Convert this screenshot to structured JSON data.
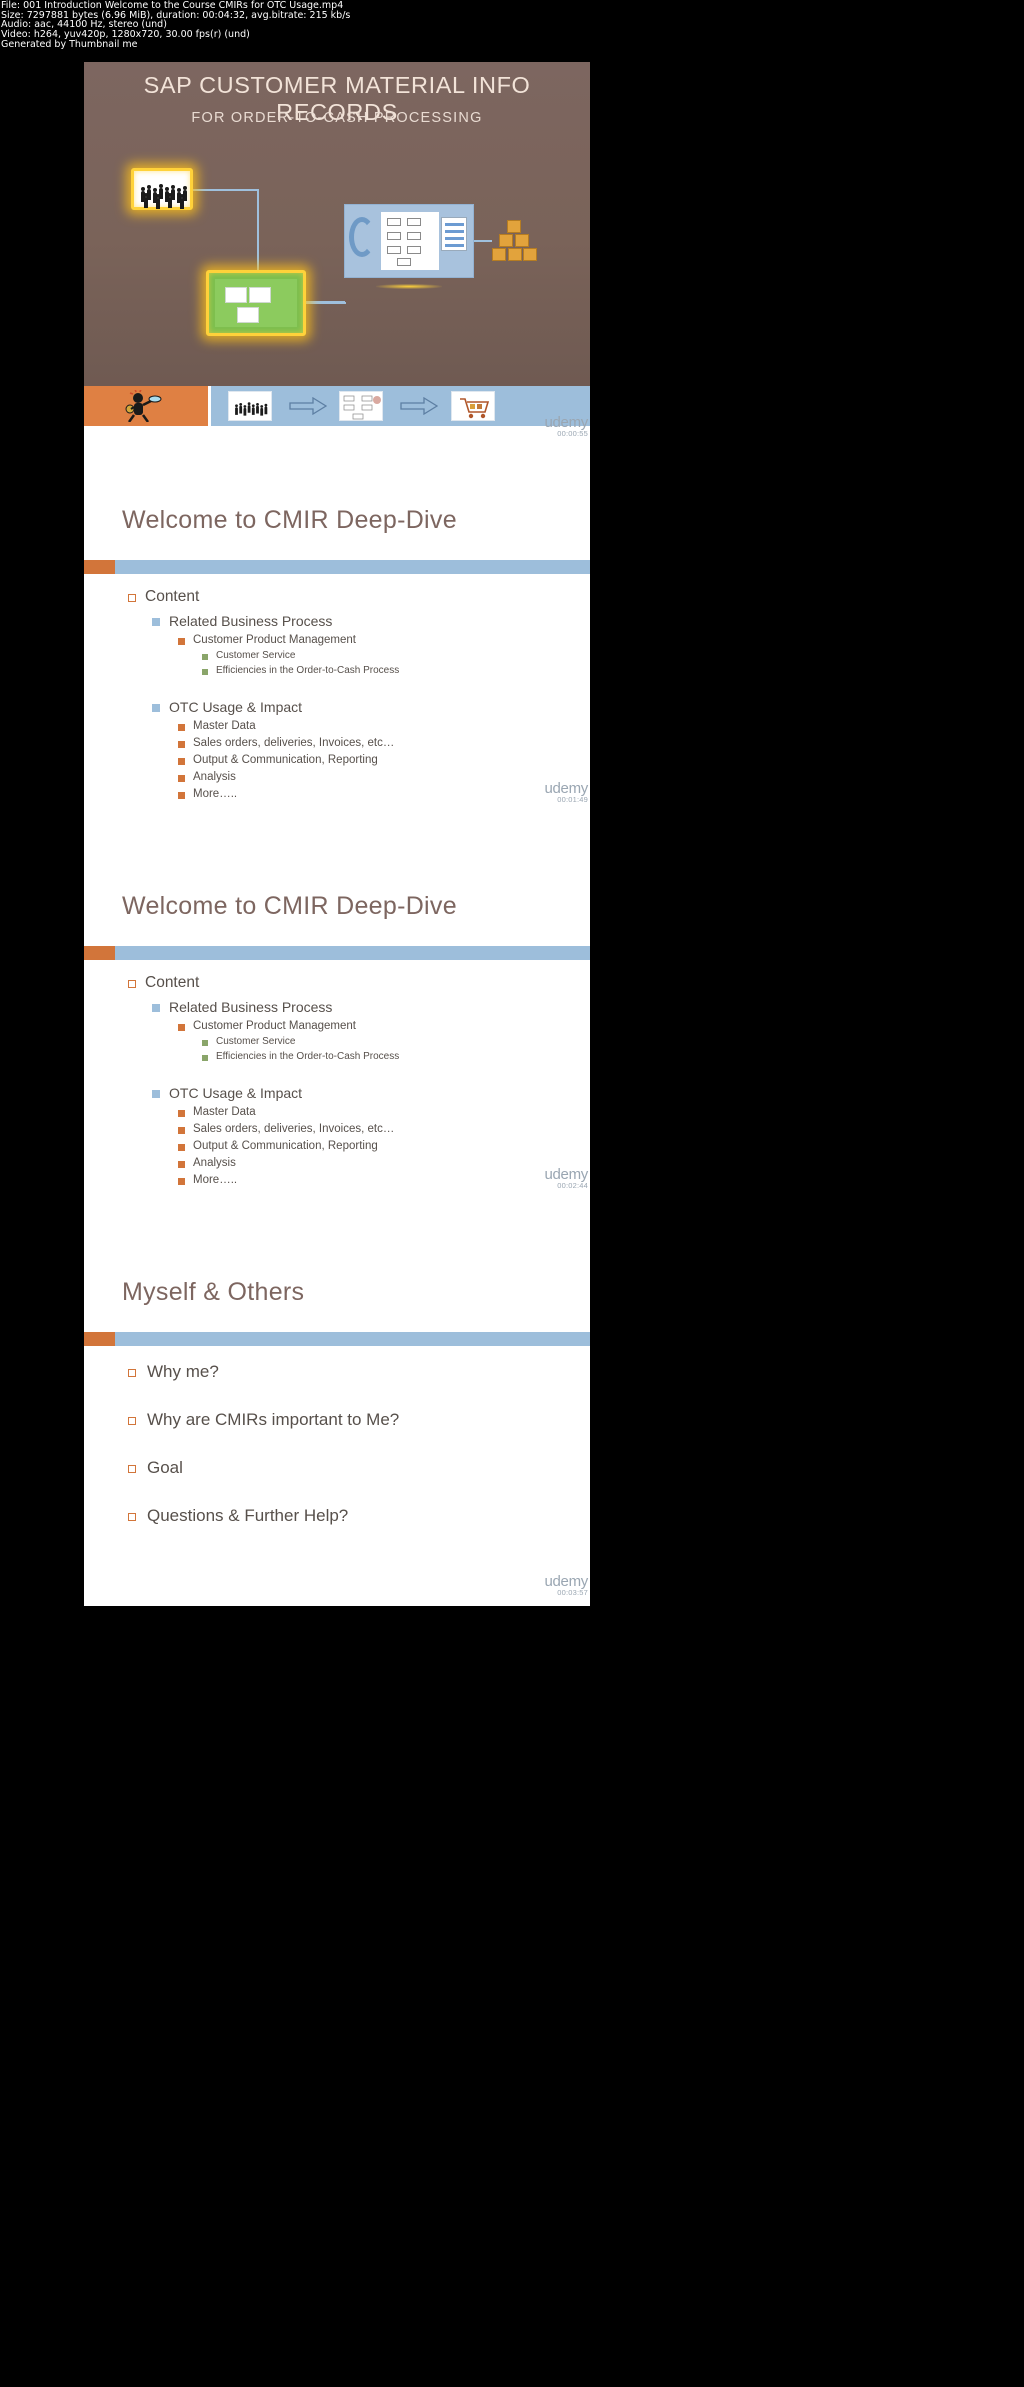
{
  "meta": {
    "line1": "File: 001 Introduction  Welcome to the Course CMIRs for OTC Usage.mp4",
    "line2": "Size: 7297881 bytes (6.96 MiB), duration: 00:04:32, avg.bitrate: 215 kb/s",
    "line3": "Audio: aac, 44100 Hz, stereo (und)",
    "line4": "Video: h264, yuv420p, 1280x720, 30.00 fps(r) (und)",
    "line5": "Generated by Thumbnail me"
  },
  "colors": {
    "slide_brown": "#7d6660",
    "strip_blue": "#9dbedb",
    "strip_orange": "#df8043",
    "accent_orange": "#d2753a",
    "bullet_green": "#8aa56a",
    "title_text": "#f2e3d8",
    "body_text": "#57504b",
    "glow_yellow": "#ffd23a"
  },
  "frames": [
    {
      "type": "title",
      "timecode": "00:00:55",
      "watermark": "udemy",
      "heading": "SAP CUSTOMER MATERIAL INFO RECORDS",
      "subheading": "FOR ORDER-TO-CASH PROCESSING"
    },
    {
      "type": "content",
      "timecode": "00:01:49",
      "watermark": "udemy",
      "title": "Welcome to CMIR Deep-Dive",
      "bullets": [
        {
          "level": 1,
          "text": "Content"
        },
        {
          "level": 2,
          "text": "Related Business Process"
        },
        {
          "level": 3,
          "text": "Customer Product Management"
        },
        {
          "level": 4,
          "text": "Customer Service"
        },
        {
          "level": 4,
          "text": "Efficiencies in the Order-to-Cash Process"
        },
        {
          "level": 2,
          "text": "OTC Usage & Impact",
          "spacer": true
        },
        {
          "level": 3,
          "text": "Master Data"
        },
        {
          "level": 3,
          "text": "Sales orders, deliveries, Invoices, etc…"
        },
        {
          "level": 3,
          "text": "Output & Communication, Reporting"
        },
        {
          "level": 3,
          "text": "Analysis"
        },
        {
          "level": 3,
          "text": "More….."
        }
      ]
    },
    {
      "type": "content",
      "timecode": "00:02:44",
      "watermark": "udemy",
      "title": "Welcome to CMIR Deep-Dive",
      "bullets": [
        {
          "level": 1,
          "text": "Content"
        },
        {
          "level": 2,
          "text": "Related Business Process"
        },
        {
          "level": 3,
          "text": "Customer Product Management"
        },
        {
          "level": 4,
          "text": "Customer Service"
        },
        {
          "level": 4,
          "text": "Efficiencies in the Order-to-Cash Process"
        },
        {
          "level": 2,
          "text": "OTC Usage & Impact",
          "spacer": true
        },
        {
          "level": 3,
          "text": "Master Data"
        },
        {
          "level": 3,
          "text": "Sales orders, deliveries, Invoices, etc…"
        },
        {
          "level": 3,
          "text": "Output & Communication, Reporting"
        },
        {
          "level": 3,
          "text": "Analysis"
        },
        {
          "level": 3,
          "text": "More….."
        }
      ]
    },
    {
      "type": "simple",
      "timecode": "00:03:57",
      "watermark": "udemy",
      "title": "Myself & Others",
      "bullets": [
        {
          "level": 1,
          "text": "Why me?"
        },
        {
          "level": 1,
          "text": "Why are CMIRs important to Me?"
        },
        {
          "level": 1,
          "text": "Goal"
        },
        {
          "level": 1,
          "text": "Questions & Further Help?"
        }
      ]
    }
  ]
}
